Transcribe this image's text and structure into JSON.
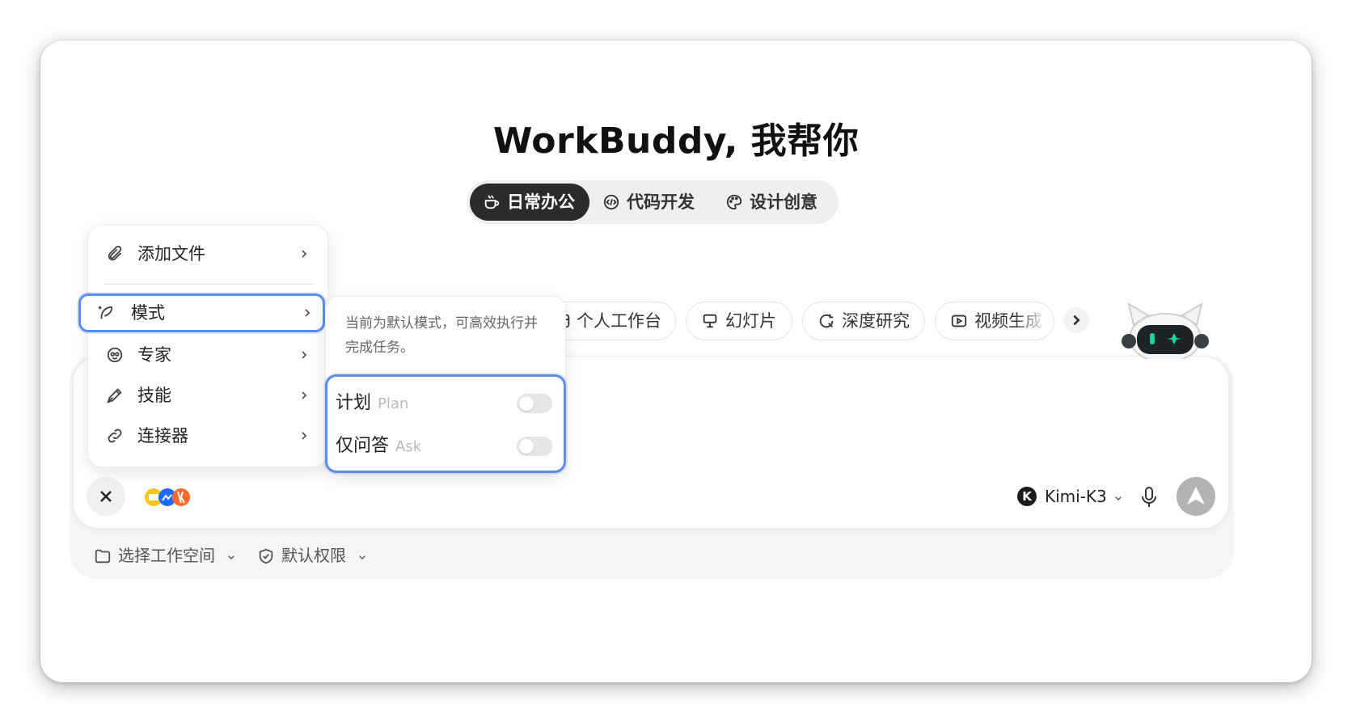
{
  "title": "WorkBuddy, 我帮你",
  "categories": [
    {
      "label": "日常办公",
      "icon": "coffee-cup-icon",
      "active": true
    },
    {
      "label": "代码开发",
      "icon": "code-icon",
      "active": false
    },
    {
      "label": "设计创意",
      "icon": "palette-icon",
      "active": false
    }
  ],
  "chips": [
    {
      "label": "个人工作台",
      "icon": "workspace-icon"
    },
    {
      "label": "幻灯片",
      "icon": "presentation-icon"
    },
    {
      "label": "深度研究",
      "icon": "research-icon"
    },
    {
      "label": "视频生成",
      "icon": "video-icon"
    }
  ],
  "menu": {
    "add_file": "添加文件",
    "mode": "模式",
    "expert": "专家",
    "skills": "技能",
    "connectors": "连接器"
  },
  "mode_panel": {
    "description": "当前为默认模式，可高效执行并完成任务。",
    "options": [
      {
        "label": "计划",
        "en": "Plan",
        "enabled": false
      },
      {
        "label": "仅问答",
        "en": "Ask",
        "enabled": false
      }
    ]
  },
  "composer": {
    "model_badge": "K",
    "model": "Kimi-K3"
  },
  "footer": {
    "workspace": "选择工作空间",
    "permission": "默认权限"
  },
  "colors": {
    "accent_highlight": "#5b8def",
    "active_segment": "#2b2b2b",
    "send_button": "#b3b3b3"
  }
}
